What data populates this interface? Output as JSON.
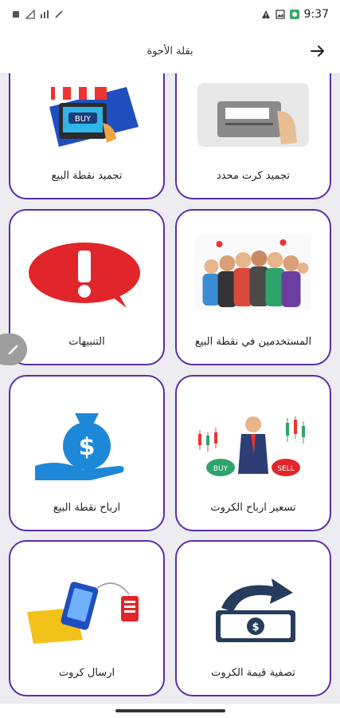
{
  "status_bar": {
    "time": "9:37",
    "left_icons": [
      "notification-icon",
      "sim-icon",
      "signal-icon",
      "pen-icon"
    ],
    "right_icons": [
      "warning-icon",
      "image-icon",
      "app-icon"
    ]
  },
  "app_bar": {
    "title": "بقلة الأحوة",
    "back_icon": "arrow-right-icon"
  },
  "colors": {
    "card_border": "#5b2ea6",
    "background": "#ececf1",
    "accent_red": "#e0262b",
    "accent_blue": "#1e88d8"
  },
  "cards": [
    {
      "id": "freeze-card",
      "label": "تجميد كرت محدد"
    },
    {
      "id": "freeze-pos",
      "label": "تجميد نقطة البيع"
    },
    {
      "id": "pos-users",
      "label": "المستخدمين في نقطة البيع"
    },
    {
      "id": "alerts",
      "label": "التنبيهات"
    },
    {
      "id": "card-profit-pricing",
      "label": "تسعير ارباح الكروت"
    },
    {
      "id": "pos-profits",
      "label": "ارباح نقطة البيع"
    },
    {
      "id": "liquidate-card-value",
      "label": "تصفية قيمة الكروت"
    },
    {
      "id": "send-cards",
      "label": "ارسال كروت"
    }
  ],
  "images": {
    "buy_button_text": "BUY",
    "sell_button_text": "SELL"
  }
}
